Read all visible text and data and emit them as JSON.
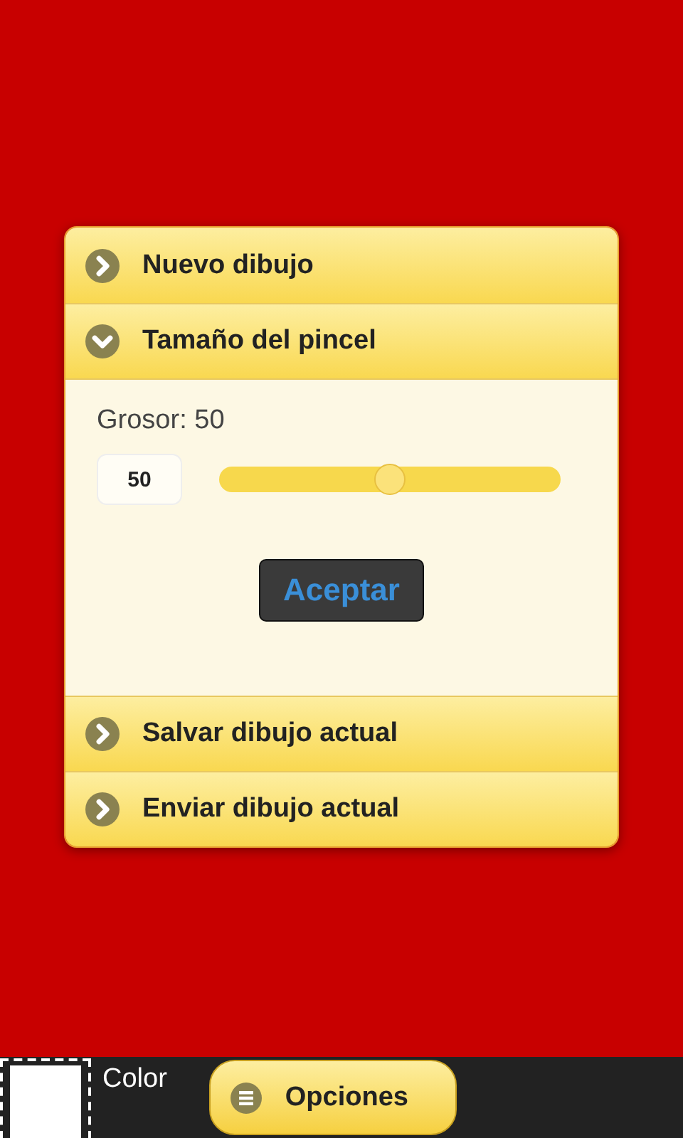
{
  "sections": [
    {
      "title": "Nuevo dibujo",
      "expanded": false
    },
    {
      "title": "Tamaño del pincel",
      "expanded": true,
      "content": {
        "label": "Grosor: 50",
        "value": "50",
        "level": 0.5,
        "button": "Aceptar"
      }
    },
    {
      "title": "Salvar dibujo actual",
      "expanded": false
    },
    {
      "title": "Enviar dibujo actual",
      "expanded": false
    }
  ],
  "footer": {
    "color_label": "Color",
    "options_button": "Opciones"
  }
}
